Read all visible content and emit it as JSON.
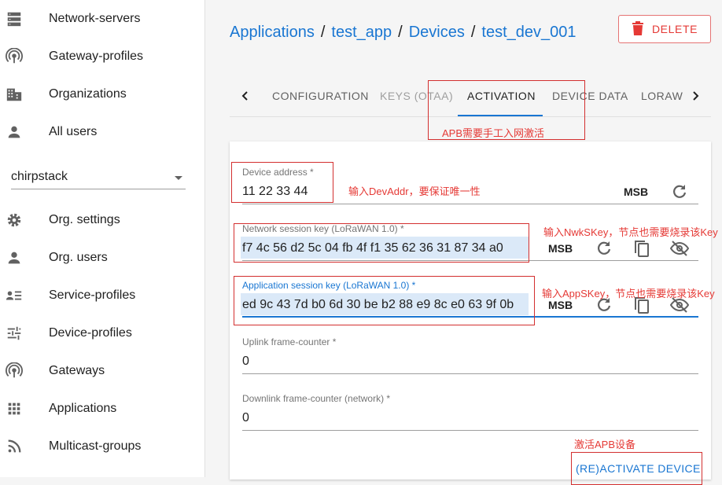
{
  "sidebar": {
    "items_top": [
      {
        "label": "Network-servers",
        "icon": "server-icon"
      },
      {
        "label": "Gateway-profiles",
        "icon": "radio-tower-icon"
      },
      {
        "label": "Organizations",
        "icon": "building-icon"
      },
      {
        "label": "All users",
        "icon": "person-icon"
      }
    ],
    "org_select": {
      "value": "chirpstack"
    },
    "items_org": [
      {
        "label": "Org. settings",
        "icon": "gear-icon"
      },
      {
        "label": "Org. users",
        "icon": "person-icon"
      },
      {
        "label": "Service-profiles",
        "icon": "account-list-icon"
      },
      {
        "label": "Device-profiles",
        "icon": "sliders-icon"
      },
      {
        "label": "Gateways",
        "icon": "radio-tower-icon"
      },
      {
        "label": "Applications",
        "icon": "apps-grid-icon"
      },
      {
        "label": "Multicast-groups",
        "icon": "rss-icon"
      }
    ]
  },
  "breadcrumb": [
    "Applications",
    "test_app",
    "Devices",
    "test_dev_001"
  ],
  "breadcrumb_sep": "/",
  "delete_label": "DELETE",
  "tabs": [
    {
      "label": "CONFIGURATION",
      "state": "normal"
    },
    {
      "label": "KEYS (OTAA)",
      "state": "disabled"
    },
    {
      "label": "ACTIVATION",
      "state": "active"
    },
    {
      "label": "DEVICE DATA",
      "state": "normal"
    },
    {
      "label": "LORAW",
      "state": "normal"
    }
  ],
  "form": {
    "device_address": {
      "label": "Device address *",
      "value": "11 22 33 44",
      "byte_order": "MSB"
    },
    "nwk_s_key": {
      "label": "Network session key (LoRaWAN 1.0) *",
      "value": "f7 4c 56 d2 5c 04 fb 4f f1 35 62 36 31 87 34 a0",
      "byte_order": "MSB"
    },
    "app_s_key": {
      "label": "Application session key (LoRaWAN 1.0) *",
      "value": "ed 9c 43 7d b0 6d 30 be b2 88 e9 8c e0 63 9f 0b",
      "byte_order": "MSB"
    },
    "uplink_fcnt": {
      "label": "Uplink frame-counter *",
      "value": "0"
    },
    "downlink_fcnt": {
      "label": "Downlink frame-counter (network) *",
      "value": "0"
    }
  },
  "activate_label": "(RE)ACTIVATE DEVICE",
  "annotations": {
    "tab_note": "APB需要手工入网激活",
    "devaddr_note": "输入DevAddr，要保证唯一性",
    "nwkskey_note": "输入NwkSKey，节点也需要烧录该Key",
    "appskey_note": "输入AppSKey，节点也需要烧录该Key",
    "activate_note": "激活APB设备"
  },
  "colors": {
    "accent": "#1976d2",
    "danger": "#e53935",
    "annotation": "#d32f2f"
  }
}
